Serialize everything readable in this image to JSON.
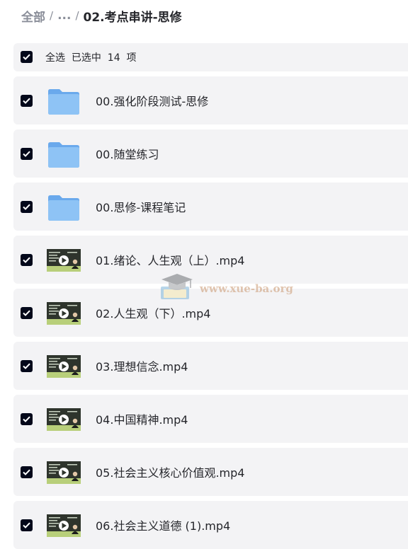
{
  "breadcrumb": {
    "root": "全部",
    "ellipsis": "...",
    "current": "02.考点串讲-思修"
  },
  "selection": {
    "text": "全选  已选中  14  项",
    "checked": true
  },
  "files": [
    {
      "name": "00.强化阶段测试-思修",
      "type": "folder",
      "checked": true
    },
    {
      "name": "00.随堂练习",
      "type": "folder",
      "checked": true
    },
    {
      "name": "00.思修-课程笔记",
      "type": "folder",
      "checked": true
    },
    {
      "name": "01.绪论、人生观（上）.mp4",
      "type": "video",
      "checked": true
    },
    {
      "name": "02.人生观（下）.mp4",
      "type": "video",
      "checked": true
    },
    {
      "name": "03.理想信念.mp4",
      "type": "video",
      "checked": true
    },
    {
      "name": "04.中国精神.mp4",
      "type": "video",
      "checked": true
    },
    {
      "name": "05.社会主义核心价值观.mp4",
      "type": "video",
      "checked": true
    },
    {
      "name": "06.社会主义道德 (1).mp4",
      "type": "video",
      "checked": true
    }
  ],
  "watermark": {
    "text": "www.xue-ba.org",
    "icon": "graduation-cap-book-icon"
  },
  "colors": {
    "row_bg": "#f3f3f5",
    "checkbox": "#03081a",
    "folder": "#7bb7f2",
    "text": "#25262b",
    "muted": "#8a8e99"
  }
}
